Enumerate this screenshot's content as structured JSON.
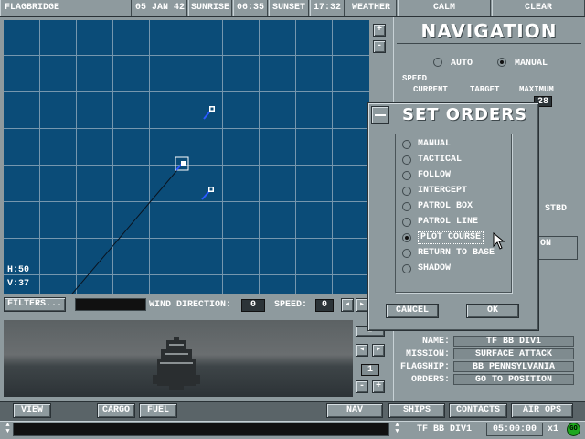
{
  "topbar": {
    "title": "FLAGBRIDGE",
    "date": "05 JAN 42",
    "sunrise_label": "SUNRISE",
    "sunrise_time": "06:35",
    "sunset_label": "SUNSET",
    "sunset_time": "17:32",
    "weather_label": "WEATHER",
    "sea": "CALM",
    "sky": "CLEAR"
  },
  "map": {
    "h_readout": "H:50",
    "v_readout": "V:37",
    "filters_label": "FILTERS...",
    "wind_label": "WIND DIRECTION:",
    "wind_value": "0",
    "speed_label": "SPEED:",
    "speed_value": "0",
    "zoom_in": "+",
    "zoom_out": "-"
  },
  "navigation": {
    "title": "NAVIGATION",
    "auto_label": "AUTO",
    "manual_label": "MANUAL",
    "speed_label": "SPEED",
    "current_label": "CURRENT",
    "target_label": "TARGET",
    "maximum_label": "MAXIMUM",
    "maximum_value": "28",
    "stbd_label": "STBD",
    "on_label": "ON"
  },
  "set_orders": {
    "title": "SET ORDERS",
    "options": [
      {
        "label": "MANUAL",
        "selected": false
      },
      {
        "label": "TACTICAL",
        "selected": false
      },
      {
        "label": "FOLLOW",
        "selected": false
      },
      {
        "label": "INTERCEPT",
        "selected": false
      },
      {
        "label": "PATROL BOX",
        "selected": false
      },
      {
        "label": "PATROL LINE",
        "selected": false
      },
      {
        "label": "PLOT COURSE",
        "selected": true
      },
      {
        "label": "RETURN TO BASE",
        "selected": false
      },
      {
        "label": "SHADOW",
        "selected": false
      }
    ],
    "cancel_label": "CANCEL",
    "ok_label": "OK"
  },
  "force_info": {
    "name_label": "NAME:",
    "name_value": "TF BB DIV1",
    "mission_label": "MISSION:",
    "mission_value": "SURFACE ATTACK",
    "flagship_label": "FLAGSHIP:",
    "flagship_value": "BB PENNSYLVANIA",
    "orders_label": "ORDERS:",
    "orders_value": "GO TO POSITION"
  },
  "view_controls": {
    "page_number": "1"
  },
  "bottom_buttons": {
    "view": "VIEW",
    "cargo": "CARGO",
    "fuel": "FUEL",
    "nav": "NAV",
    "ships": "SHIPS",
    "contacts": "CONTACTS",
    "air_ops": "AIR OPS"
  },
  "statusbar": {
    "unit": "TF BB DIV1",
    "time": "05:00:00",
    "speed_mult": "x1",
    "go_label": "GO"
  },
  "colors": {
    "ocean": "#0b4c78",
    "grid": "#9ab0c0",
    "panel": "#8e9a9e",
    "go_green": "#1fa81f"
  }
}
